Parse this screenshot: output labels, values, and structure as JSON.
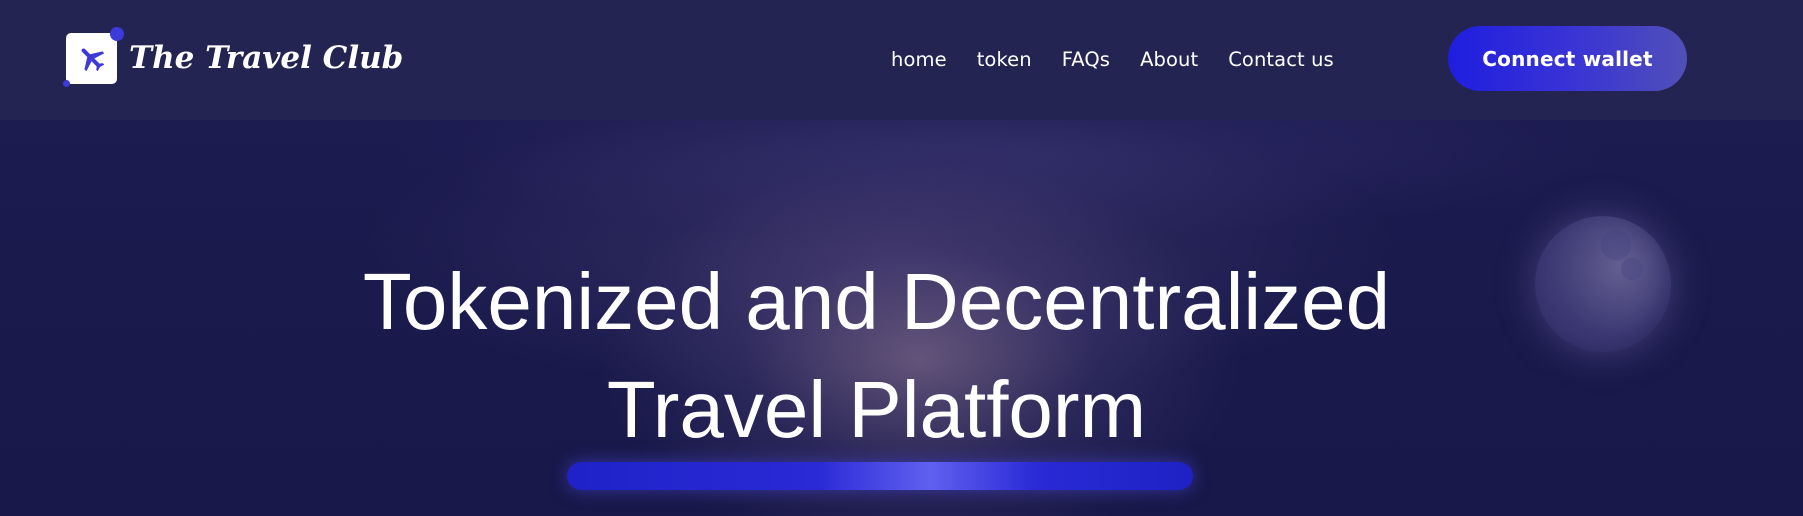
{
  "brand": {
    "name": "The Travel Club",
    "logo_icon": "airplane-icon",
    "accent_color": "#3c3ad8"
  },
  "nav": {
    "items": [
      {
        "label": "home"
      },
      {
        "label": "token"
      },
      {
        "label": "FAQs"
      },
      {
        "label": "About"
      },
      {
        "label": "Contact us"
      }
    ]
  },
  "header": {
    "connect_wallet_label": "Connect wallet"
  },
  "hero": {
    "title_line1": "Tokenized and Decentralized",
    "title_line2": "Travel Platform",
    "decoration_icon": "moon-icon"
  },
  "colors": {
    "background": "#18184a",
    "header_background": "#242452",
    "button_gradient_start": "#1f1ee0",
    "button_gradient_end": "#5150b8",
    "hero_bar": "#2a2ad6",
    "text": "#ffffff"
  }
}
